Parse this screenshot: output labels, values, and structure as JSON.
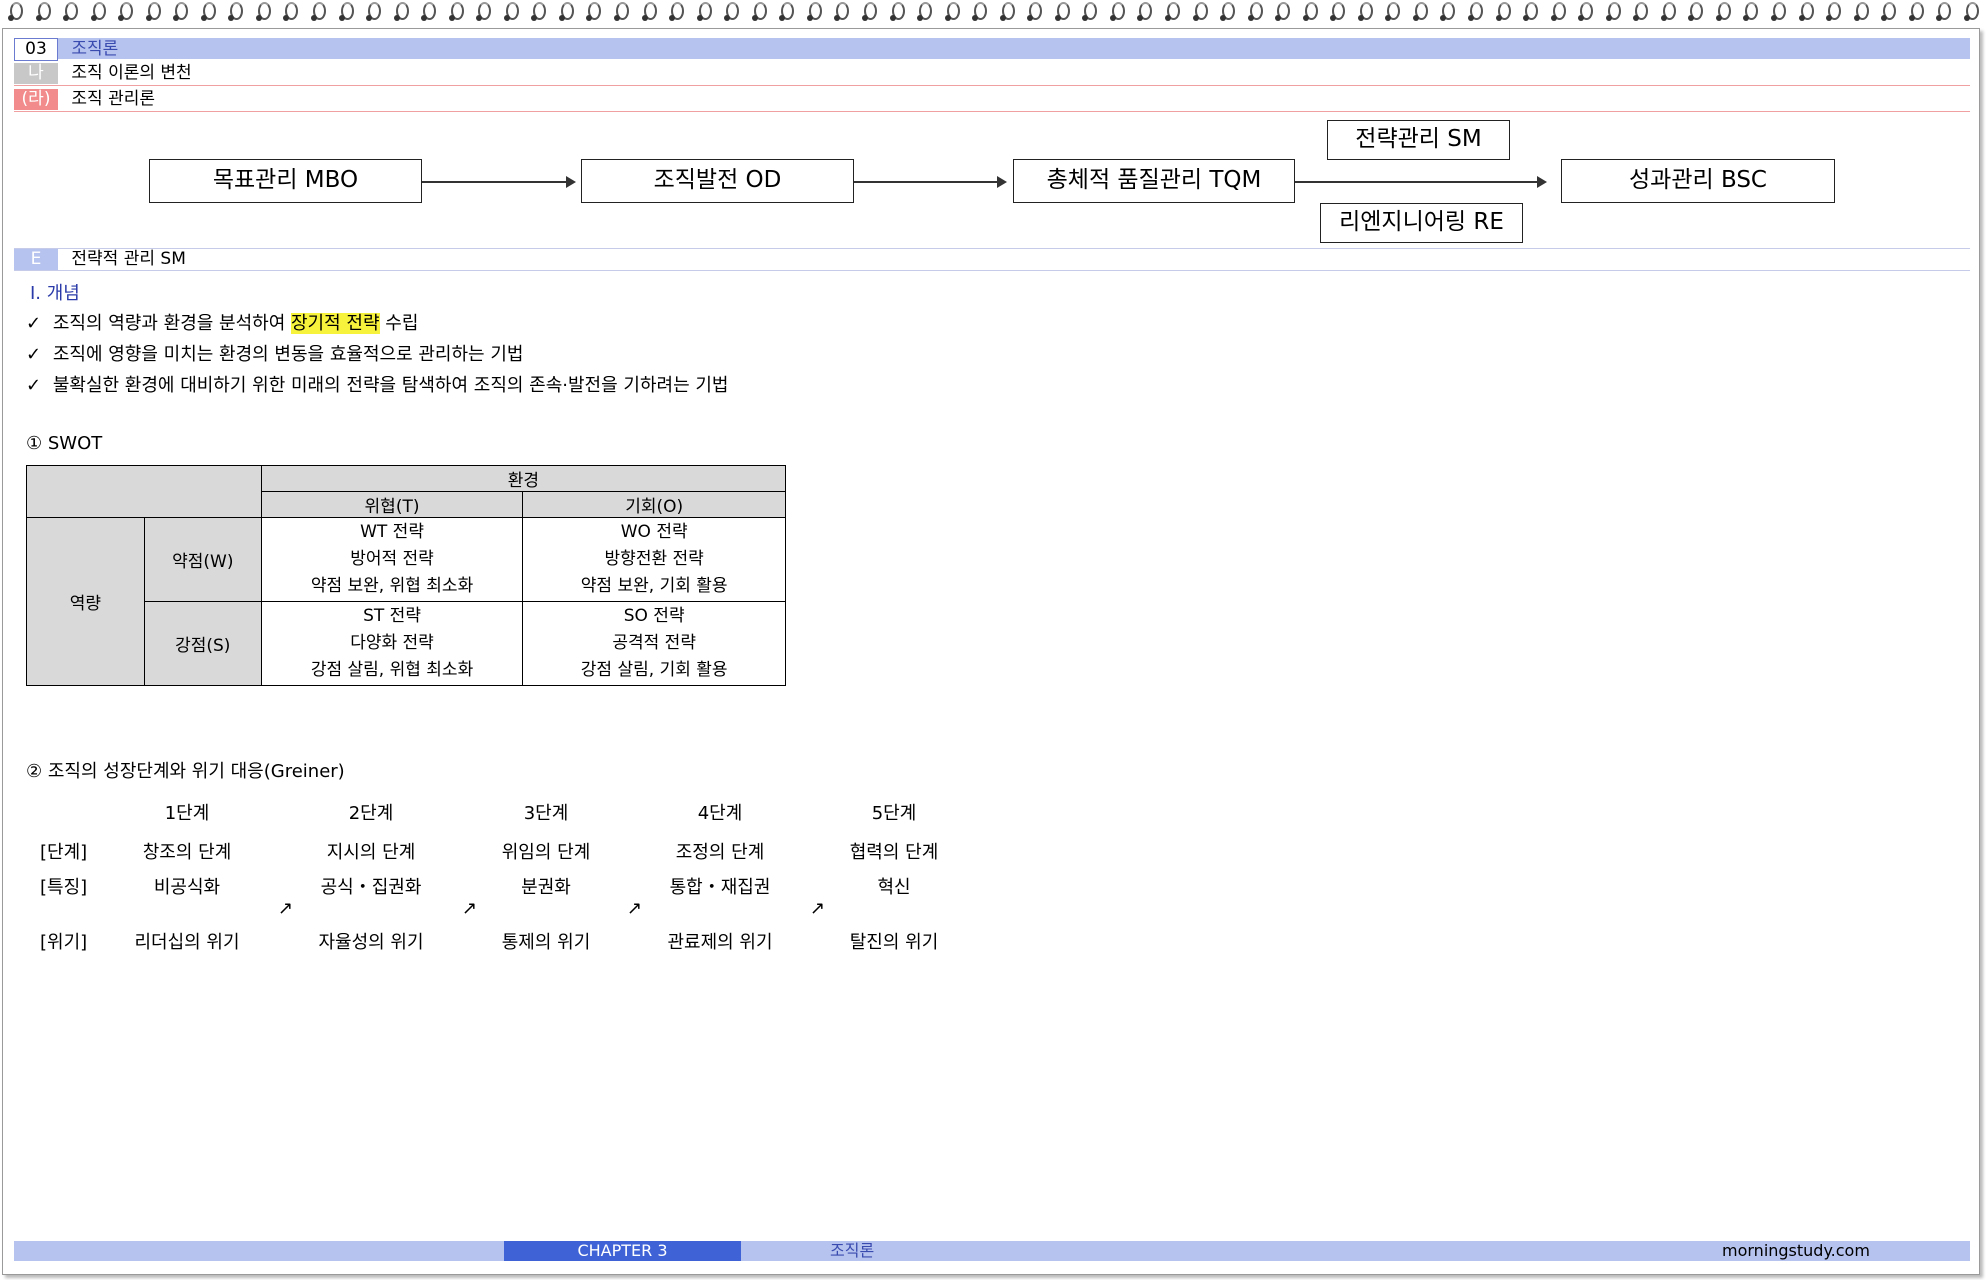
{
  "header": {
    "chapter_num": "03",
    "chapter_title": "조직론",
    "section_num": "나",
    "section_title": "조직 이론의 변천",
    "sub_num": "(라)",
    "sub_title": "조직 관리론"
  },
  "flow": {
    "mbo": "목표관리  MBO",
    "od": "조직발전 OD",
    "tqm": "총체적 품질관리 TQM",
    "sm": "전략관리 SM",
    "re": "리엔지니어링 RE",
    "bsc": "성과관리 BSC"
  },
  "section_e": {
    "num": "E",
    "title": "전략적 관리 SM"
  },
  "concept": {
    "heading": "Ⅰ. 개념",
    "check": "✓",
    "items": [
      {
        "before": "조직의 역량과 환경을 분석하여 ",
        "highlight": "장기적 전략",
        "after": " 수립"
      },
      {
        "before": "조직에 영향을 미치는 환경의 변동을 효율적으로 관리하는 기법",
        "highlight": "",
        "after": ""
      },
      {
        "before": "불확실한 환경에 대비하기 위한 미래의 전략을 탐색하여 조직의 존속·발전을 기하려는 기법",
        "highlight": "",
        "after": ""
      }
    ]
  },
  "swot": {
    "heading": "① SWOT",
    "env": "환경",
    "threat": "위협(T)",
    "opportunity": "기회(O)",
    "capability": "역량",
    "weakness": "약점(W)",
    "strength": "강점(S)",
    "wt": {
      "title": "WT 전략",
      "name": "방어적 전략",
      "desc": "약점 보완, 위협 최소화"
    },
    "wo": {
      "title": "WO 전략",
      "name": "방향전환 전략",
      "desc": "약점 보완, 기회 활용"
    },
    "st": {
      "title": "ST 전략",
      "name": "다양화 전략",
      "desc": "강점 살림, 위협 최소화"
    },
    "so": {
      "title": "SO 전략",
      "name": "공격적 전략",
      "desc": "강점 살림, 기회 활용"
    }
  },
  "greiner": {
    "heading": "② 조직의 성장단계와 위기 대응(Greiner)",
    "row_labels": {
      "stage": "[단계]",
      "feature": "[특징]",
      "crisis": "[위기]"
    },
    "arrow": "↗",
    "stages": [
      {
        "step": "1단계",
        "stage": "창조의 단계",
        "feature": "비공식화",
        "crisis": "리더십의 위기"
      },
      {
        "step": "2단계",
        "stage": "지시의 단계",
        "feature": "공식・집권화",
        "crisis": "자율성의 위기"
      },
      {
        "step": "3단계",
        "stage": "위임의 단계",
        "feature": "분권화",
        "crisis": "통제의 위기"
      },
      {
        "step": "4단계",
        "stage": "조정의 단계",
        "feature": "통합・재집권",
        "crisis": "관료제의 위기"
      },
      {
        "step": "5단계",
        "stage": "협력의 단계",
        "feature": "혁신",
        "crisis": "탈진의 위기"
      }
    ]
  },
  "footer": {
    "chapter": "CHAPTER  3",
    "title": "조직론",
    "site": "morningstudy.com"
  },
  "colors": {
    "bar_blue": "#b6c3ee",
    "chapter_box": "#3f63d6",
    "red_label": "#f28b8b",
    "highlight": "#f7f23c",
    "table_gray": "#d9d9d9"
  }
}
